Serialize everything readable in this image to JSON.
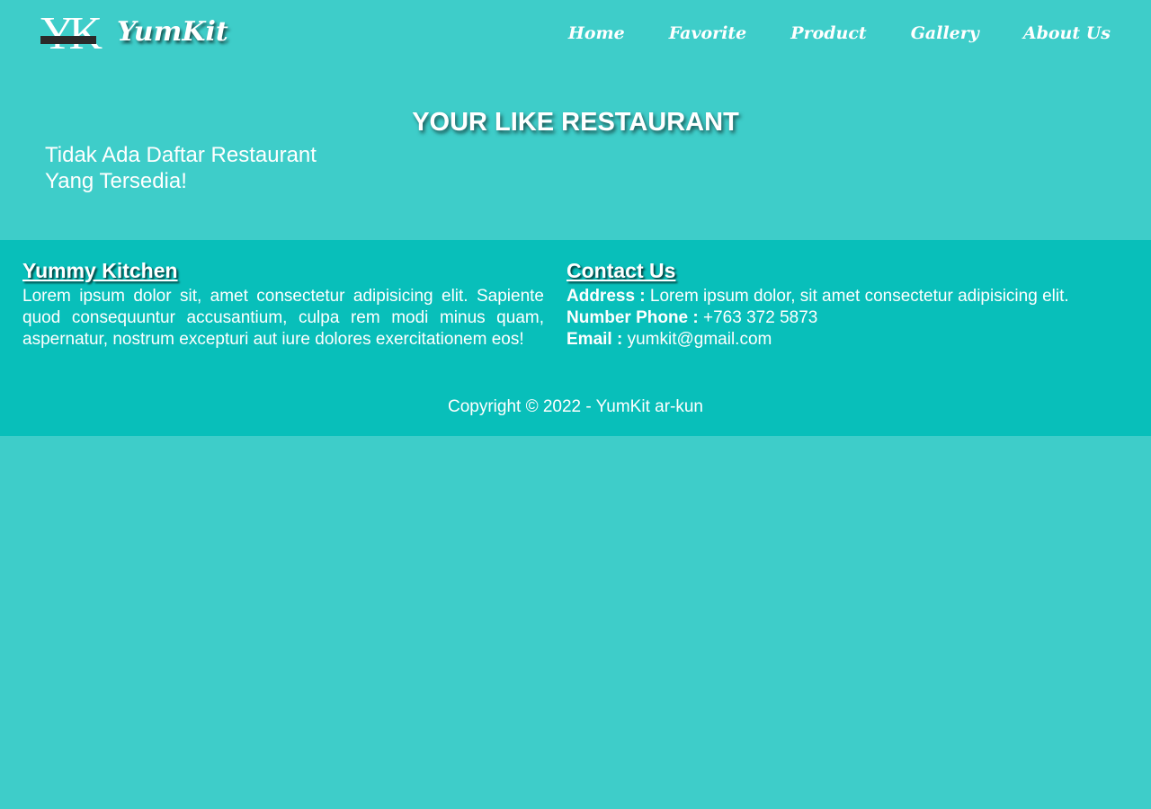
{
  "header": {
    "logo_alt": "YK",
    "logo_subtext": "YUMMY KITCHEN",
    "brand": "YumKit",
    "nav": [
      {
        "label": "Home"
      },
      {
        "label": "Favorite"
      },
      {
        "label": "Product"
      },
      {
        "label": "Gallery"
      },
      {
        "label": "About Us"
      }
    ]
  },
  "main": {
    "title": "YOUR LIKE RESTAURANT",
    "empty_message": "Tidak Ada Daftar Restaurant Yang Tersedia!"
  },
  "footer": {
    "about": {
      "heading": "Yummy Kitchen",
      "text": "Lorem ipsum dolor sit, amet consectetur adipisicing elit. Sapiente quod consequuntur accusantium, culpa rem modi minus quam, aspernatur, nostrum excepturi aut iure dolores exercitationem eos!"
    },
    "contact": {
      "heading": "Contact Us",
      "address_label": "Address :",
      "address_value": "Lorem ipsum dolor, sit amet consectetur adipisicing elit.",
      "phone_label": "Number Phone :",
      "phone_value": "+763 372 5873",
      "email_label": "Email :",
      "email_value": "yumkit@gmail.com"
    },
    "copyright": "Copyright © 2022 - YumKit ar-kun"
  },
  "colors": {
    "page_background": "#3ecdc9",
    "footer_background": "#08bfba",
    "text": "#ffffff"
  }
}
